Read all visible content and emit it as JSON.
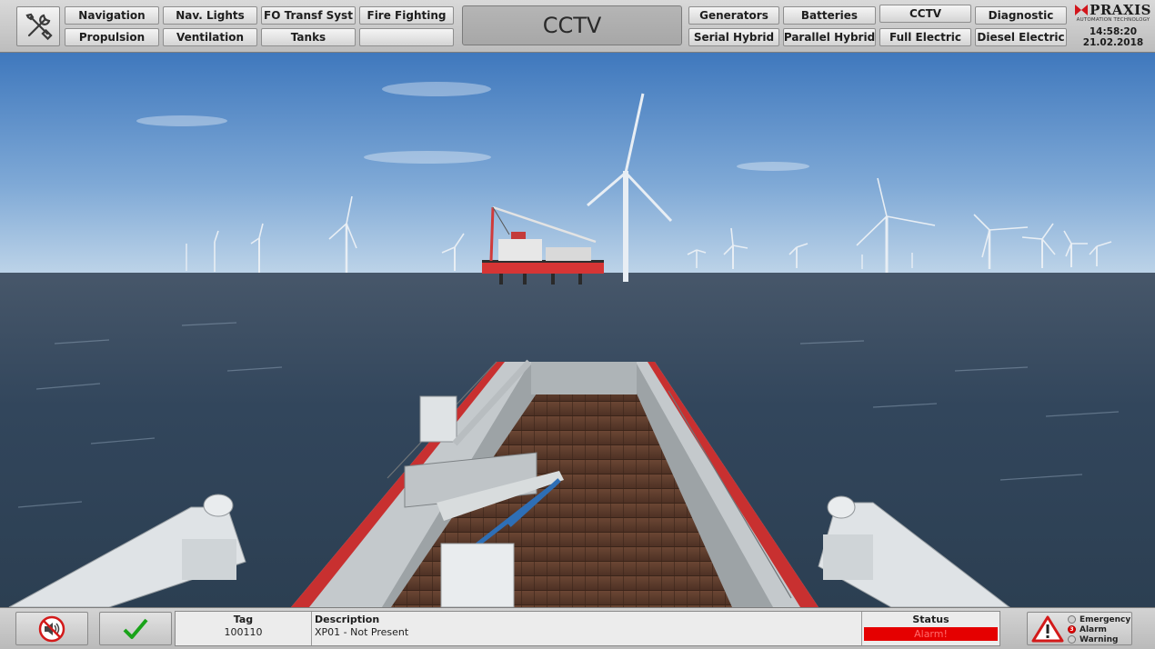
{
  "topbar": {
    "left_buttons": [
      {
        "label": "Navigation"
      },
      {
        "label": "Nav. Lights"
      },
      {
        "label": "FO Transf Syst"
      },
      {
        "label": "Fire Fighting"
      },
      {
        "label": "Propulsion"
      },
      {
        "label": "Ventilation"
      },
      {
        "label": "Tanks"
      },
      {
        "label": ""
      }
    ],
    "page_title": "CCTV",
    "right_buttons": [
      {
        "label": "Generators"
      },
      {
        "label": "Batteries"
      },
      {
        "label": "CCTV"
      },
      {
        "label": "Diagnostic"
      },
      {
        "label": "Serial Hybrid"
      },
      {
        "label": "Parallel Hybrid"
      },
      {
        "label": "Full Electric"
      },
      {
        "label": "Diesel Electric"
      }
    ]
  },
  "brand": {
    "name": "PRAXIS",
    "subtitle": "AUTOMATION TECHNOLOGY",
    "time": "14:58:20",
    "date": "21.02.2018"
  },
  "alarm": {
    "tag_header": "Tag",
    "tag_value": "100110",
    "description_header": "Description",
    "description_value": "XP01 - Not Present",
    "status_header": "Status",
    "status_value": "Alarm!"
  },
  "legend": {
    "emergency_label": "Emergency",
    "alarm_label": "Alarm",
    "alarm_count": "3",
    "warning_label": "Warning"
  },
  "colors": {
    "alarm_red": "#e50000",
    "acknowledge_green": "#1aa31a"
  },
  "icons": {
    "tools": "tools-icon",
    "mute": "mute-horn-icon",
    "acknowledge": "checkmark-icon",
    "warning": "warning-triangle-icon"
  }
}
